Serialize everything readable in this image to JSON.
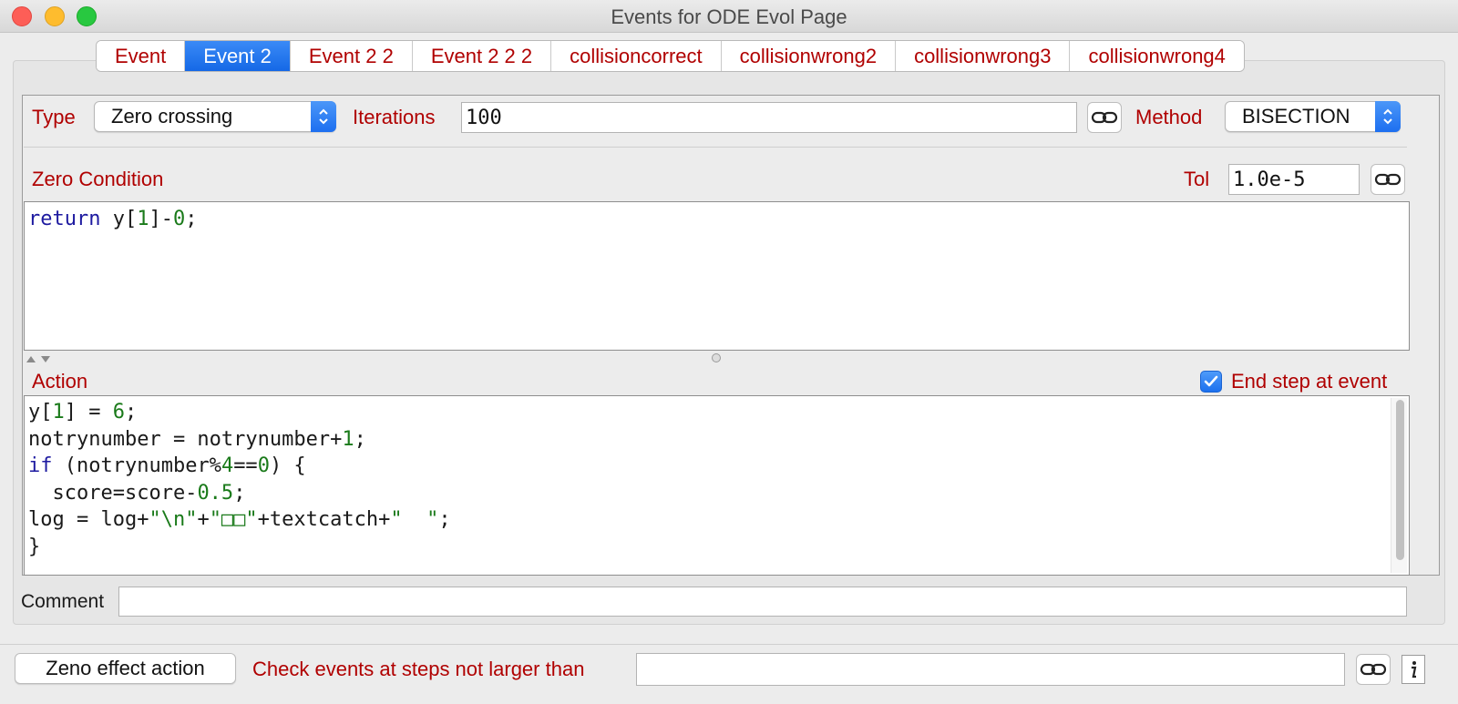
{
  "window": {
    "title": "Events for ODE Evol Page"
  },
  "tabs": [
    {
      "label": "Event",
      "active": false
    },
    {
      "label": "Event 2",
      "active": true
    },
    {
      "label": "Event 2 2",
      "active": false
    },
    {
      "label": "Event 2 2 2",
      "active": false
    },
    {
      "label": "collisioncorrect",
      "active": false
    },
    {
      "label": "collisionwrong2",
      "active": false
    },
    {
      "label": "collisionwrong3",
      "active": false
    },
    {
      "label": "collisionwrong4",
      "active": false
    }
  ],
  "event": {
    "type_label": "Type",
    "type_value": "Zero crossing",
    "iterations_label": "Iterations",
    "iterations_value": "100",
    "method_label": "Method",
    "method_value": "BISECTION",
    "zero_condition_label": "Zero Condition",
    "tol_label": "Tol",
    "tol_value": "1.0e-5",
    "zero_condition_code": {
      "line1": {
        "kw": "return",
        "a": " y[",
        "n1": "1",
        "b": "]-",
        "n2": "0",
        "c": ";"
      }
    },
    "action_label": "Action",
    "end_step_label": "End step at event",
    "end_step_checked": true,
    "action_code": {
      "l1": {
        "a": "y[",
        "n1": "1",
        "b": "] = ",
        "n2": "6",
        "c": ";"
      },
      "l2": {
        "a": "notrynumber = notrynumber+",
        "n1": "1",
        "c": ";"
      },
      "l3": {
        "kw": "if",
        "a": " (notrynumber%",
        "n1": "4",
        "b": "==",
        "n2": "0",
        "c": ") {"
      },
      "l4": {
        "a": "  score=score-",
        "n1": "0.5",
        "c": ";"
      },
      "l5": {
        "a": "log = log+",
        "s1": "\"\\n\"",
        "b": "+",
        "s2": "\"□□\"",
        "c": "+textcatch+",
        "s3": "\"  \"",
        "d": ";"
      },
      "l6": {
        "a": "}"
      }
    },
    "comment_label": "Comment",
    "comment_value": ""
  },
  "footer": {
    "zeno_button": "Zeno effect action",
    "check_steps_label": "Check events at steps not larger than",
    "check_steps_value": ""
  },
  "icons": {
    "link": "link-icon",
    "info": "info-icon"
  },
  "colors": {
    "label_red": "#b00000",
    "accent_blue": "#1568e6"
  }
}
